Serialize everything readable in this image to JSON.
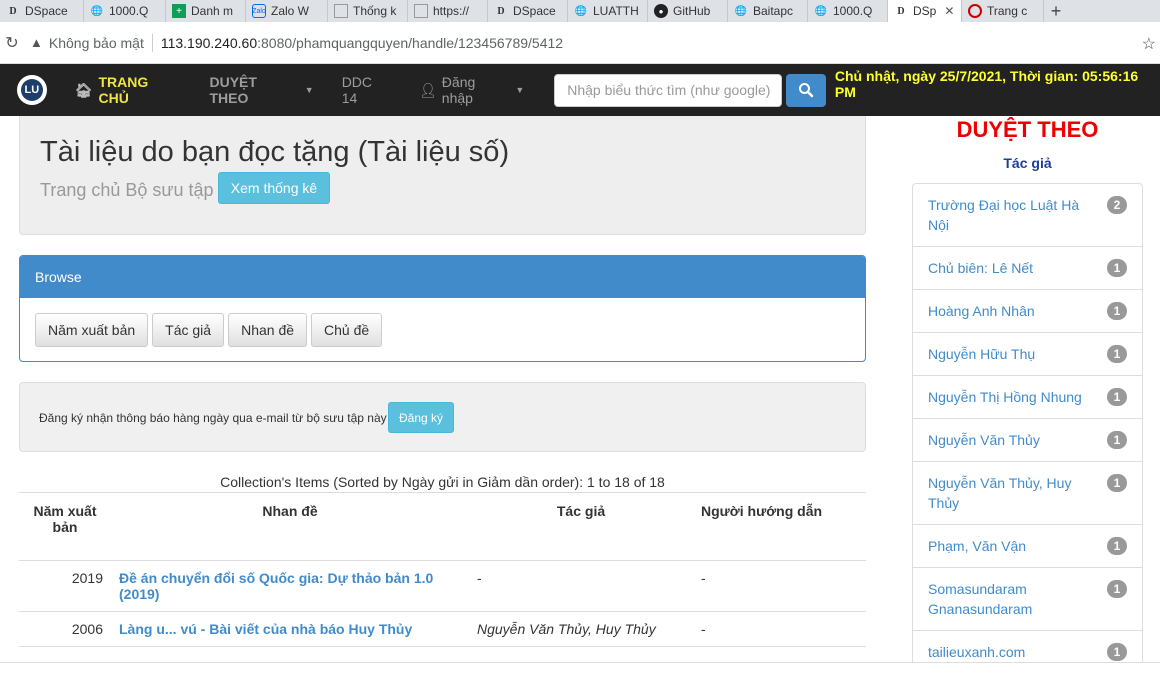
{
  "browser": {
    "tabs": [
      {
        "label": "DSpace",
        "icon": "dspace-icon"
      },
      {
        "label": "1000.Q",
        "icon": "globe-icon"
      },
      {
        "label": "Danh m",
        "icon": "sheets-icon"
      },
      {
        "label": "Zalo W",
        "icon": "zalo-icon"
      },
      {
        "label": "Thống k",
        "icon": "doc-icon"
      },
      {
        "label": "https://",
        "icon": "doc-icon"
      },
      {
        "label": "DSpace",
        "icon": "dspace-icon"
      },
      {
        "label": "LUATTH",
        "icon": "globe-icon"
      },
      {
        "label": "GitHub",
        "icon": "github-icon"
      },
      {
        "label": "Baitapc",
        "icon": "globe-icon"
      },
      {
        "label": "1000.Q",
        "icon": "globe-icon"
      },
      {
        "label": "DSp",
        "icon": "dspace-icon"
      },
      {
        "label": "Trang c",
        "icon": "red-logo-icon"
      }
    ],
    "new_tab": "+",
    "insecure_label": "Không bảo mật",
    "url_host": "113.190.240.60",
    "url_rest": ":8080/phamquangquyen/handle/123456789/5412"
  },
  "nav": {
    "logo_text": "LU",
    "home": "TRANG CHỦ",
    "browse": "DUYỆT THEO",
    "ddc": "DDC 14",
    "login": "Đăng nhập",
    "search_placeholder": "Nhập biểu thức tìm (như google)",
    "clock": "Chủ nhật, ngày 25/7/2021, Thời gian: 05:56:16 PM"
  },
  "header": {
    "title": "Tài liệu do bạn đọc tặng (Tài liệu số)",
    "breadcrumb": "Trang chủ Bộ sưu tập",
    "stats_button": "Xem thống kê"
  },
  "browse": {
    "heading": "Browse",
    "buttons": [
      "Năm xuất bản",
      "Tác giả",
      "Nhan đề",
      "Chủ đề"
    ]
  },
  "subscribe": {
    "text": "Đăng ký nhận thông báo hàng ngày qua e-mail từ bộ sưu tập này",
    "button": "Đăng ký"
  },
  "items": {
    "sorted_text": "Collection's Items (Sorted by Ngày gửi in Giảm dần order): 1 to 18 of 18",
    "columns": [
      "Năm xuất bản",
      "Nhan đề",
      "Tác giả",
      "Người hướng dẫn"
    ],
    "rows": [
      {
        "year": "2019",
        "title": "Đề án chuyển đổi số Quốc gia: Dự thảo bản 1.0 (2019)",
        "author": "-",
        "advisor": "-"
      },
      {
        "year": "2006",
        "title": "Làng u... vú - Bài viết của nhà báo Huy Thủy",
        "author": "Nguyễn Văn Thủy, Huy Thủy",
        "advisor": "-"
      }
    ]
  },
  "sidebar": {
    "title": "DUYỆT THEO",
    "subtitle": "Tác giả",
    "authors": [
      {
        "name": "Trường Đại học Luật Hà Nội",
        "count": "2"
      },
      {
        "name": "Chủ biên: Lê Nết",
        "count": "1"
      },
      {
        "name": "Hoàng Anh Nhân",
        "count": "1"
      },
      {
        "name": "Nguyễn Hữu Thụ",
        "count": "1"
      },
      {
        "name": "Nguyễn Thị Hồng Nhung",
        "count": "1"
      },
      {
        "name": "Nguyễn Văn Thủy",
        "count": "1"
      },
      {
        "name": "Nguyễn Văn Thủy, Huy Thủy",
        "count": "1"
      },
      {
        "name": "Phạm, Văn Vận",
        "count": "1"
      },
      {
        "name": "Somasundaram Gnanasundaram",
        "count": "1"
      },
      {
        "name": "tailieuxanh.com",
        "count": "1"
      }
    ]
  },
  "colors": {
    "navbar": "#222222",
    "home": "#f0e442",
    "clock": "#ffff33",
    "primary": "#428bca",
    "info": "#5bc0de",
    "sidebar_title": "#ee0000"
  }
}
